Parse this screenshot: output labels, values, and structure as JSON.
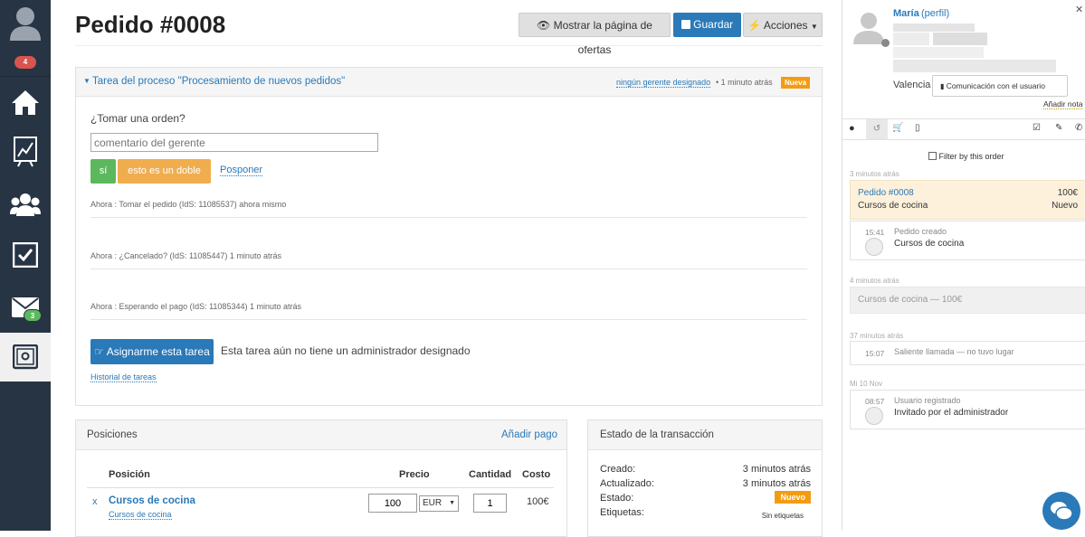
{
  "sidebar": {
    "badge_notifications": "4",
    "badge_messages": "3"
  },
  "header": {
    "title": "Pedido #0008",
    "show_offers_label": "Mostrar la página de ofertas",
    "save_label": "Guardar",
    "actions_label": "Acciones"
  },
  "task": {
    "title": "Tarea del proceso \"Procesamiento de nuevos pedidos\"",
    "manager_link": "ningún gerente designado",
    "time": "• 1 minuto atrás",
    "badge": "Nueva",
    "question": "¿Tomar una orden?",
    "comment_placeholder": "comentario del gerente",
    "yes_label": "sí",
    "double_label": "esto es un doble",
    "postpone_label": "Posponer",
    "history": [
      "Ahora : Tomar el pedido (IdS: 11085537) ahora mismo",
      "Ahora : ¿Cancelado? (IdS: 11085447) 1 minuto atrás",
      "Ahora : Esperando el pago (IdS: 11085344) 1 minuto atrás"
    ],
    "assign_label": "Asignarme esta tarea",
    "no_admin_text": "Esta tarea aún no tiene un administrador designado",
    "task_history_link": "Historial de tareas"
  },
  "positions": {
    "title": "Posiciones",
    "add_payment": "Añadir pago",
    "col_position": "Posición",
    "col_price": "Precio",
    "col_qty": "Cantidad",
    "col_cost": "Costo",
    "rows": [
      {
        "remove": "x",
        "name": "Cursos de cocina",
        "sub": "Cursos de cocina",
        "price": "100",
        "currency": "EUR",
        "qty": "1",
        "cost": "100€"
      }
    ]
  },
  "transaction": {
    "title": "Estado de la transacción",
    "created_label": "Creado:",
    "created_value": "3 minutos atrás",
    "updated_label": "Actualizado:",
    "updated_value": "3 minutos atrás",
    "status_label": "Estado:",
    "status_value": "Nuevo",
    "tags_label": "Etiquetas:",
    "tags_value": "Sin etiquetas"
  },
  "customer": {
    "name": "María",
    "profile_link": "(perfil)",
    "city": "Valencia",
    "comm_button": "Comunicación con el usuario",
    "add_note": "Añadir nota",
    "filter_label": "Filter by this order"
  },
  "timeline": {
    "group1_time": "3 minutos atrás",
    "order_title": "Pedido #0008",
    "order_amount": "100€",
    "order_item": "Cursos de cocina",
    "order_status": "Nuevo",
    "event1_time": "15:41",
    "event1_title": "Pedido creado",
    "event1_sub": "Cursos de cocina",
    "group2_time": "4 minutos atrás",
    "prev_item": "Cursos de cocina — 100€",
    "group3_time": "37 minutos atrás",
    "event2_time": "15:07",
    "event2_title": "Saliente llamada — no tuvo lugar",
    "group4_time": "Mi 10 Nov",
    "event3_time": "08:57",
    "event3_title": "Usuario registrado",
    "event3_sub": "Invitado por el administrador"
  },
  "colors": {
    "sidebar": "#263444",
    "accent": "#2a79b8",
    "orange": "#f0ad4e",
    "green": "#5cb85c",
    "badge_new": "#f39c12"
  }
}
